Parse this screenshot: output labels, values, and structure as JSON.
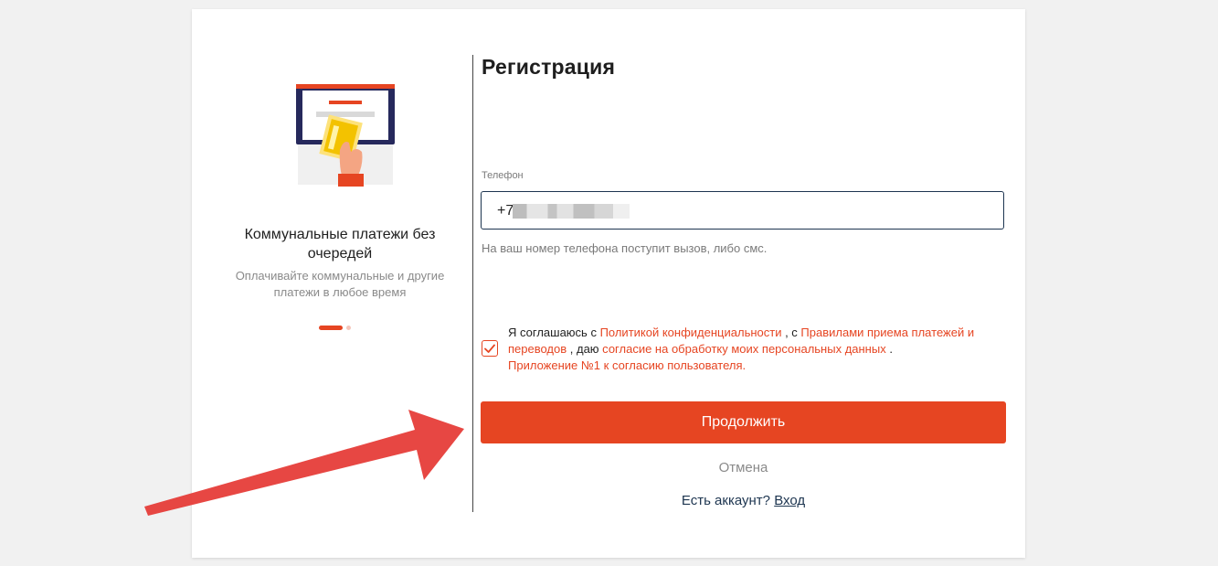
{
  "promo": {
    "title": "Коммунальные платежи без очередей",
    "subtitle": "Оплачивайте коммунальные и другие платежи в любое время",
    "slide_count": 2,
    "active_slide": 1
  },
  "form": {
    "title": "Регистрация",
    "phone_label": "Телефон",
    "phone_prefix": "+7",
    "phone_hint": "На ваш номер телефона поступит вызов, либо смс.",
    "agreement": {
      "checked": true,
      "t1": "Я соглашаюсь с ",
      "link_privacy": "Политикой конфиденциальности",
      "t2": " , с ",
      "link_rules": "Правилами приема платежей и переводов",
      "t3": " , даю ",
      "link_consent": "согласие на обработку моих персональных данных",
      "t4": " .",
      "link_appendix": "Приложение №1 к согласию пользователя."
    },
    "continue_label": "Продолжить",
    "cancel_label": "Отмена",
    "login_prompt": "Есть аккаунт? ",
    "login_link": "Вход"
  },
  "colors": {
    "accent": "#e64522",
    "navy": "#1d3550",
    "annotation_arrow": "#e53935"
  },
  "icons": {
    "checkbox": "check-icon",
    "annotation": "arrow-annotation"
  }
}
